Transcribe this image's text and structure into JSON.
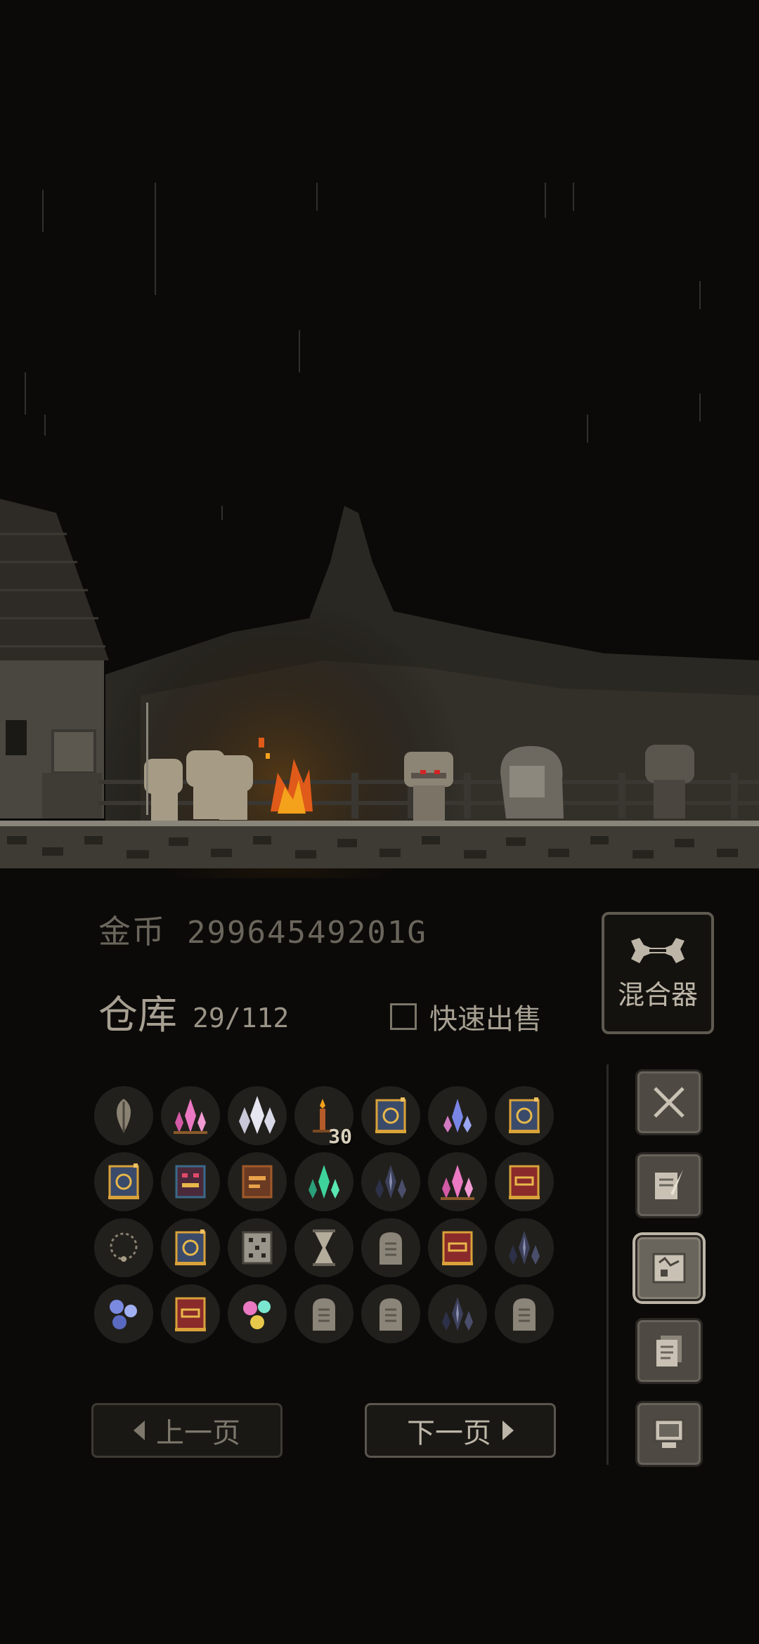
{
  "gold": {
    "label": "金币",
    "value": "29964549201G"
  },
  "storage": {
    "label": "仓库",
    "count": "29/112"
  },
  "quick_sell": {
    "label": "快速出售",
    "checked": false
  },
  "mixer": {
    "label": "混合器"
  },
  "pagination": {
    "prev_label": "上一页",
    "next_label": "下一页"
  },
  "inventory": [
    {
      "icon": "leaf-icon"
    },
    {
      "icon": "pink-crystal-icon"
    },
    {
      "icon": "white-crystal-icon"
    },
    {
      "icon": "candle-icon",
      "qty": "30"
    },
    {
      "icon": "gold-book-icon"
    },
    {
      "icon": "blue-crystal-icon"
    },
    {
      "icon": "gold-book-icon"
    },
    {
      "icon": "gold-book-icon"
    },
    {
      "icon": "demon-book-icon"
    },
    {
      "icon": "brown-book-icon"
    },
    {
      "icon": "green-crystal-icon"
    },
    {
      "icon": "dark-crystal-icon"
    },
    {
      "icon": "pink-crystal-icon"
    },
    {
      "icon": "red-book-icon"
    },
    {
      "icon": "necklace-icon"
    },
    {
      "icon": "gold-book-icon"
    },
    {
      "icon": "dice-box-icon"
    },
    {
      "icon": "hourglass-icon"
    },
    {
      "icon": "tombstone-icon"
    },
    {
      "icon": "red-book-icon"
    },
    {
      "icon": "dark-crystal-icon"
    },
    {
      "icon": "blue-orbs-icon"
    },
    {
      "icon": "red-book-icon"
    },
    {
      "icon": "rainbow-orbs-icon"
    },
    {
      "icon": "tombstone-icon"
    },
    {
      "icon": "tombstone-icon"
    },
    {
      "icon": "dark-crystal-icon"
    },
    {
      "icon": "tombstone-icon"
    }
  ],
  "side_menu": [
    {
      "icon": "crossed-swords-icon",
      "active": false
    },
    {
      "icon": "scroll-quill-icon",
      "active": false
    },
    {
      "icon": "map-icon",
      "active": true
    },
    {
      "icon": "documents-icon",
      "active": false
    },
    {
      "icon": "computer-icon",
      "active": false
    }
  ]
}
